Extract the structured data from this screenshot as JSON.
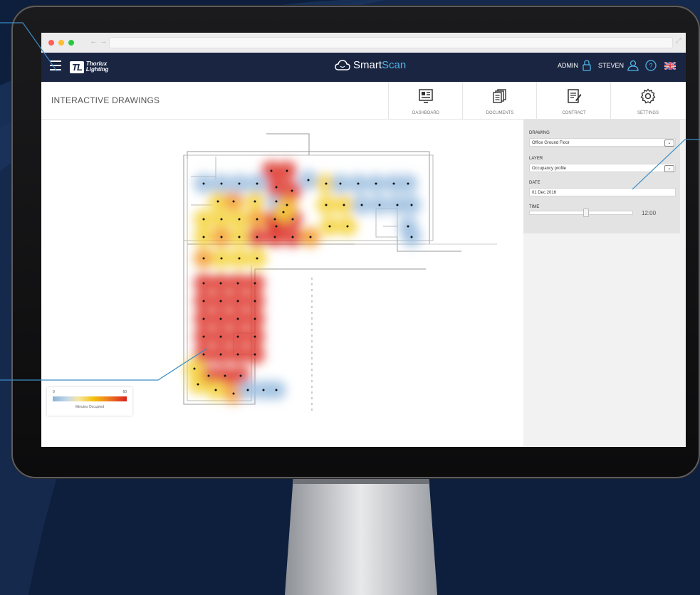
{
  "app": {
    "brand_mark": "TL",
    "brand_name_line1": "Thorlux",
    "brand_name_line2": "Lighting",
    "logo_part1": "Smart",
    "logo_part2": "Scan",
    "admin_label": "ADMIN",
    "user_label": "STEVEN"
  },
  "page": {
    "title": "INTERACTIVE DRAWINGS"
  },
  "nav": [
    {
      "label": "DASHBOARD",
      "icon": "dashboard-icon"
    },
    {
      "label": "DOCUMENTS",
      "icon": "documents-icon"
    },
    {
      "label": "CONTRACT",
      "icon": "contract-icon"
    },
    {
      "label": "SETTINGS",
      "icon": "gear-icon"
    }
  ],
  "panel": {
    "drawing_label": "DRAWING",
    "drawing_value": "Office Ground Floor",
    "layer_label": "LAYER",
    "layer_value": "Occupancy profile",
    "date_label": "DATE",
    "date_value": "01 Dec 2016",
    "time_label": "TIME",
    "time_value": "12:00",
    "time_slider_fraction": 0.55
  },
  "legend": {
    "min": "0",
    "max": "60",
    "label": "Minutes Occupied"
  },
  "colors": {
    "header_bg": "#1a2541",
    "accent": "#4fb3e6",
    "heat_low": "#8bb2d8",
    "heat_mid": "#f4c20d",
    "heat_high": "#d8221e"
  }
}
